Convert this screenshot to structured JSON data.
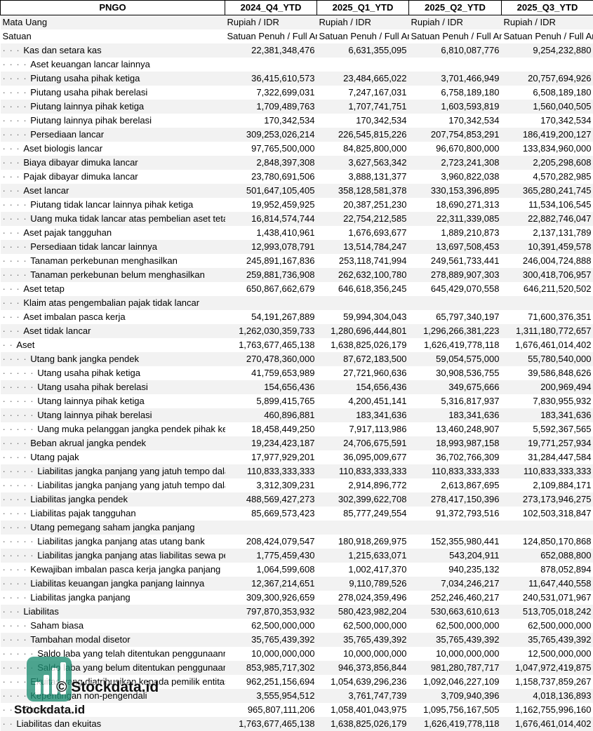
{
  "header": {
    "ticker": "PNGO",
    "periods": [
      "2024_Q4_YTD",
      "2025_Q1_YTD",
      "2025_Q2_YTD",
      "2025_Q3_YTD"
    ]
  },
  "rows": [
    {
      "label": "Mata Uang",
      "dots": "",
      "values": [
        "Rupiah / IDR",
        "Rupiah / IDR",
        "Rupiah / IDR",
        "Rupiah / IDR"
      ],
      "align": "left"
    },
    {
      "label": "Satuan",
      "dots": "",
      "values": [
        "Satuan Penuh / Full Amount",
        "Satuan Penuh / Full Amount",
        "Satuan Penuh / Full Amount",
        "Satuan Penuh / Full Amount"
      ],
      "align": "left"
    },
    {
      "label": "Kas dan setara kas",
      "dots": "· · · ",
      "values": [
        "22,381,348,476",
        "6,631,355,095",
        "6,810,087,776",
        "9,254,232,880"
      ]
    },
    {
      "label": "Aset keuangan lancar lainnya",
      "dots": "· · · · ",
      "values": [
        "",
        "",
        "",
        ""
      ]
    },
    {
      "label": "Piutang usaha pihak ketiga",
      "dots": "· · · · ",
      "values": [
        "36,415,610,573",
        "23,484,665,022",
        "3,701,466,949",
        "20,757,694,926"
      ]
    },
    {
      "label": "Piutang usaha pihak berelasi",
      "dots": "· · · · ",
      "values": [
        "7,322,699,031",
        "7,247,167,031",
        "6,758,189,180",
        "6,508,189,180"
      ]
    },
    {
      "label": "Piutang lainnya pihak ketiga",
      "dots": "· · · · ",
      "values": [
        "1,709,489,763",
        "1,707,741,751",
        "1,603,593,819",
        "1,560,040,505"
      ]
    },
    {
      "label": "Piutang lainnya pihak berelasi",
      "dots": "· · · · ",
      "values": [
        "170,342,534",
        "170,342,534",
        "170,342,534",
        "170,342,534"
      ]
    },
    {
      "label": "Persediaan lancar",
      "dots": "· · · · ",
      "values": [
        "309,253,026,214",
        "226,545,815,226",
        "207,754,853,291",
        "186,419,200,127"
      ]
    },
    {
      "label": "Aset biologis lancar",
      "dots": "· · · ",
      "values": [
        "97,765,500,000",
        "84,825,800,000",
        "96,670,800,000",
        "133,834,960,000"
      ]
    },
    {
      "label": "Biaya dibayar dimuka lancar",
      "dots": "· · · ",
      "values": [
        "2,848,397,308",
        "3,627,563,342",
        "2,723,241,308",
        "2,205,298,608"
      ]
    },
    {
      "label": "Pajak dibayar dimuka lancar",
      "dots": "· · · ",
      "values": [
        "23,780,691,506",
        "3,888,131,377",
        "3,960,822,038",
        "4,570,282,985"
      ]
    },
    {
      "label": "Aset lancar",
      "dots": "· · · ",
      "values": [
        "501,647,105,405",
        "358,128,581,378",
        "330,153,396,895",
        "365,280,241,745"
      ]
    },
    {
      "label": "Piutang tidak lancar lainnya pihak ketiga",
      "dots": "· · · · ",
      "values": [
        "19,952,459,925",
        "20,387,251,230",
        "18,690,271,313",
        "11,534,106,545"
      ]
    },
    {
      "label": "Uang muka tidak lancar atas pembelian aset tetap",
      "dots": "· · · · ",
      "values": [
        "16,814,574,744",
        "22,754,212,585",
        "22,311,339,085",
        "22,882,746,047"
      ]
    },
    {
      "label": "Aset pajak tangguhan",
      "dots": "· · · ",
      "values": [
        "1,438,410,961",
        "1,676,693,677",
        "1,889,210,873",
        "2,137,131,789"
      ]
    },
    {
      "label": "Persediaan tidak lancar lainnya",
      "dots": "· · · · ",
      "values": [
        "12,993,078,791",
        "13,514,784,247",
        "13,697,508,453",
        "10,391,459,578"
      ]
    },
    {
      "label": "Tanaman perkebunan menghasilkan",
      "dots": "· · · · ",
      "values": [
        "245,891,167,836",
        "253,118,741,994",
        "249,561,733,441",
        "246,004,724,888"
      ]
    },
    {
      "label": "Tanaman perkebunan belum menghasilkan",
      "dots": "· · · · ",
      "values": [
        "259,881,736,908",
        "262,632,100,780",
        "278,889,907,303",
        "300,418,706,957"
      ]
    },
    {
      "label": "Aset tetap",
      "dots": "· · · ",
      "values": [
        "650,867,662,679",
        "646,618,356,245",
        "645,429,070,558",
        "646,211,520,502"
      ]
    },
    {
      "label": "Klaim atas pengembalian pajak tidak lancar",
      "dots": "· · · ",
      "values": [
        "",
        "",
        "",
        ""
      ]
    },
    {
      "label": "Aset imbalan pasca kerja",
      "dots": "· · · ",
      "values": [
        "54,191,267,889",
        "59,994,304,043",
        "65,797,340,197",
        "71,600,376,351"
      ]
    },
    {
      "label": "Aset tidak lancar",
      "dots": "· · · ",
      "values": [
        "1,262,030,359,733",
        "1,280,696,444,801",
        "1,296,266,381,223",
        "1,311,180,772,657"
      ]
    },
    {
      "label": "Aset",
      "dots": "· · ",
      "values": [
        "1,763,677,465,138",
        "1,638,825,026,179",
        "1,626,419,778,118",
        "1,676,461,014,402"
      ]
    },
    {
      "label": "Utang bank jangka pendek",
      "dots": "· · · · ",
      "values": [
        "270,478,360,000",
        "87,672,183,500",
        "59,054,575,000",
        "55,780,540,000"
      ]
    },
    {
      "label": "Utang usaha pihak ketiga",
      "dots": "· · · · · ",
      "values": [
        "41,759,653,989",
        "27,721,960,636",
        "30,908,536,755",
        "39,586,848,626"
      ]
    },
    {
      "label": "Utang usaha pihak berelasi",
      "dots": "· · · · · ",
      "values": [
        "154,656,436",
        "154,656,436",
        "349,675,666",
        "200,969,494"
      ]
    },
    {
      "label": "Utang lainnya pihak ketiga",
      "dots": "· · · · · ",
      "values": [
        "5,899,415,765",
        "4,200,451,141",
        "5,316,817,937",
        "7,830,955,932"
      ]
    },
    {
      "label": "Utang lainnya pihak berelasi",
      "dots": "· · · · · ",
      "values": [
        "460,896,881",
        "183,341,636",
        "183,341,636",
        "183,341,636"
      ]
    },
    {
      "label": "Uang muka pelanggan jangka pendek pihak ketiga",
      "dots": "· · · · · ",
      "values": [
        "18,458,449,250",
        "7,917,113,986",
        "13,460,248,907",
        "5,592,367,565"
      ]
    },
    {
      "label": "Beban akrual jangka pendek",
      "dots": "· · · · ",
      "values": [
        "19,234,423,187",
        "24,706,675,591",
        "18,993,987,158",
        "19,771,257,934"
      ]
    },
    {
      "label": "Utang pajak",
      "dots": "· · · · ",
      "values": [
        "17,977,929,201",
        "36,095,009,677",
        "36,702,766,309",
        "31,284,447,584"
      ]
    },
    {
      "label": "Liabilitas jangka panjang yang jatuh tempo dalam satu tahun",
      "dots": "· · · · · ",
      "values": [
        "110,833,333,333",
        "110,833,333,333",
        "110,833,333,333",
        "110,833,333,333"
      ]
    },
    {
      "label": "Liabilitas jangka panjang yang jatuh tempo dalam satu tahun",
      "dots": "· · · · · ",
      "values": [
        "3,312,309,231",
        "2,914,896,772",
        "2,613,867,695",
        "2,109,884,171"
      ]
    },
    {
      "label": "Liabilitas jangka pendek",
      "dots": "· · · · ",
      "values": [
        "488,569,427,273",
        "302,399,622,708",
        "278,417,150,396",
        "273,173,946,275"
      ]
    },
    {
      "label": "Liabilitas pajak tangguhan",
      "dots": "· · · · ",
      "values": [
        "85,669,573,423",
        "85,777,249,554",
        "91,372,793,516",
        "102,503,318,847"
      ]
    },
    {
      "label": "Utang pemegang saham jangka panjang",
      "dots": "· · · · ",
      "values": [
        "",
        "",
        "",
        ""
      ]
    },
    {
      "label": "Liabilitas jangka panjang atas utang bank",
      "dots": "· · · · · ",
      "values": [
        "208,424,079,547",
        "180,918,269,975",
        "152,355,980,441",
        "124,850,170,868"
      ]
    },
    {
      "label": "Liabilitas jangka panjang atas liabilitas sewa pembiayaan",
      "dots": "· · · · · ",
      "values": [
        "1,775,459,430",
        "1,215,633,071",
        "543,204,911",
        "652,088,800"
      ]
    },
    {
      "label": "Kewajiban imbalan pasca kerja jangka panjang",
      "dots": "· · · · ",
      "values": [
        "1,064,599,608",
        "1,002,417,370",
        "940,235,132",
        "878,052,894"
      ]
    },
    {
      "label": "Liabilitas keuangan jangka panjang lainnya",
      "dots": "· · · · ",
      "values": [
        "12,367,214,651",
        "9,110,789,526",
        "7,034,246,217",
        "11,647,440,558"
      ]
    },
    {
      "label": "Liabilitas jangka panjang",
      "dots": "· · · · ",
      "values": [
        "309,300,926,659",
        "278,024,359,496",
        "252,246,460,217",
        "240,531,071,967"
      ]
    },
    {
      "label": "Liabilitas",
      "dots": "· · · ",
      "values": [
        "797,870,353,932",
        "580,423,982,204",
        "530,663,610,613",
        "513,705,018,242"
      ]
    },
    {
      "label": "Saham biasa",
      "dots": "· · · · ",
      "values": [
        "62,500,000,000",
        "62,500,000,000",
        "62,500,000,000",
        "62,500,000,000"
      ]
    },
    {
      "label": "Tambahan modal disetor",
      "dots": "· · · · ",
      "values": [
        "35,765,439,392",
        "35,765,439,392",
        "35,765,439,392",
        "35,765,439,392"
      ]
    },
    {
      "label": "Saldo laba yang telah ditentukan penggunaannya",
      "dots": "· · · · · ",
      "values": [
        "10,000,000,000",
        "10,000,000,000",
        "10,000,000,000",
        "12,500,000,000"
      ]
    },
    {
      "label": "Saldo laba yang belum ditentukan penggunaannya",
      "dots": "· · · · · ",
      "values": [
        "853,985,717,302",
        "946,373,856,844",
        "981,280,787,717",
        "1,047,972,419,875"
      ]
    },
    {
      "label": "Ekuitas yang diatribusikan kepada pemilik entitas induk",
      "dots": "· · · · ",
      "values": [
        "962,251,156,694",
        "1,054,639,296,236",
        "1,092,046,227,109",
        "1,158,737,859,267"
      ]
    },
    {
      "label": "Kepentingan non-pengendali",
      "dots": "· · · · ",
      "values": [
        "3,555,954,512",
        "3,761,747,739",
        "3,709,940,396",
        "4,018,136,893"
      ]
    },
    {
      "label": "Ekuitas",
      "dots": "· · · ",
      "values": [
        "965,807,111,206",
        "1,058,401,043,975",
        "1,095,756,167,505",
        "1,162,755,996,160"
      ]
    },
    {
      "label": "Liabilitas dan ekuitas",
      "dots": "· · ",
      "values": [
        "1,763,677,465,138",
        "1,638,825,026,179",
        "1,626,419,778,118",
        "1,676,461,014,402"
      ]
    }
  ],
  "watermark": {
    "brand": "© Stockdata.id",
    "url": "Stockdata.id",
    "color": "#1e8e73"
  }
}
